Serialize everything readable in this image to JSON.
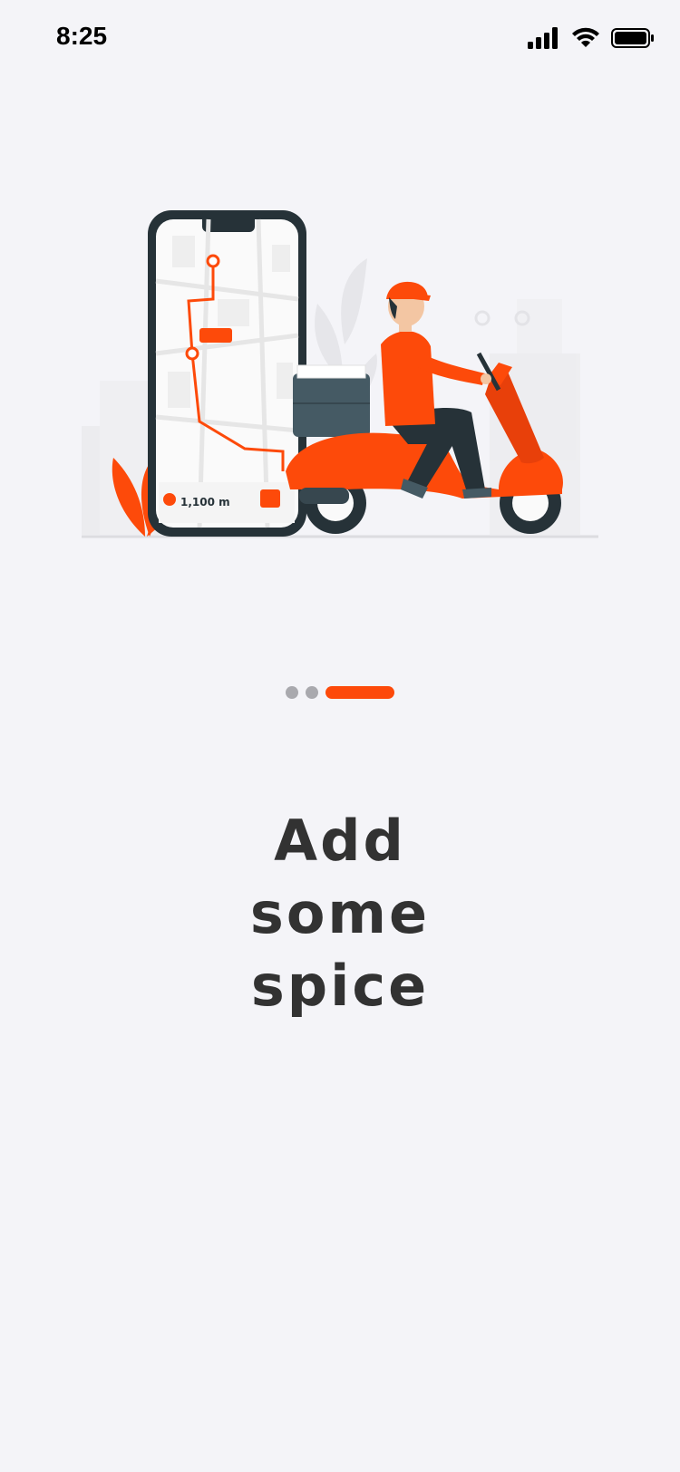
{
  "status_bar": {
    "time": "8:25"
  },
  "illustration": {
    "phone_card_value": "1,100 m",
    "accent_color": "#fd4a0a"
  },
  "pager": {
    "count": 3,
    "active_index": 2
  },
  "headline": {
    "lines": [
      "Add",
      "some",
      "spice"
    ]
  }
}
